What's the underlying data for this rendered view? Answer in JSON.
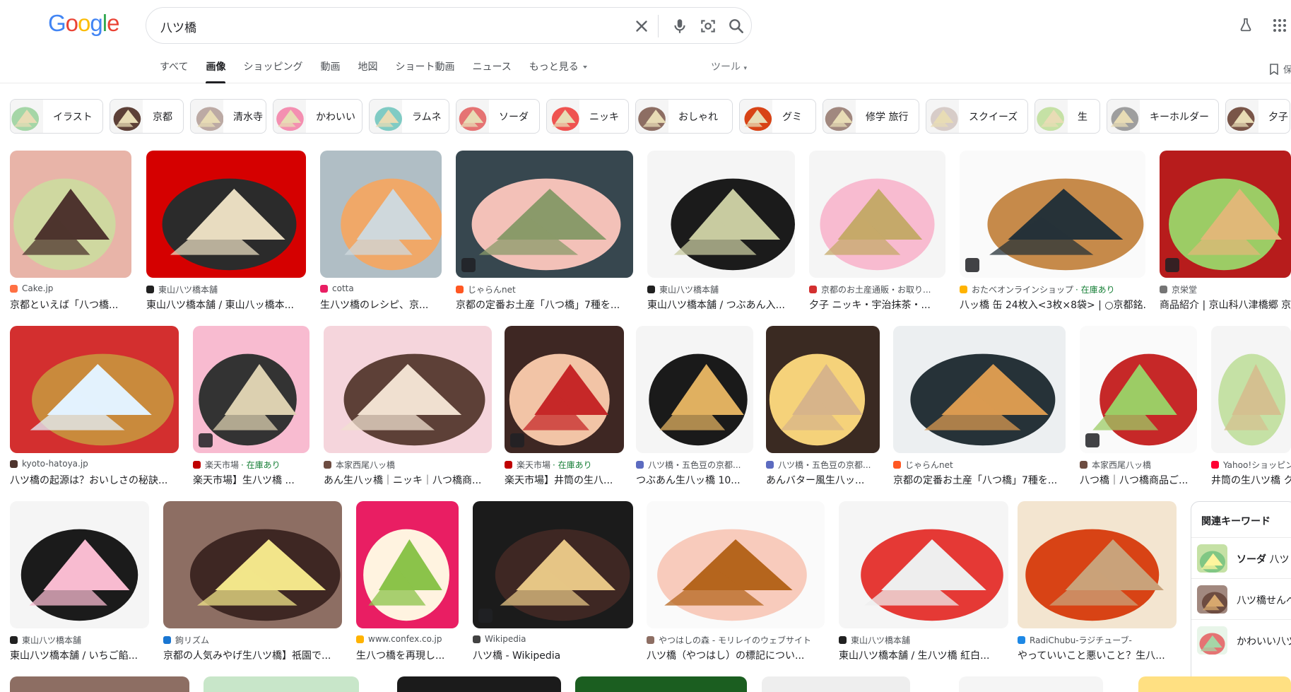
{
  "header": {
    "logo": "Google",
    "search_value": "八ツ橋",
    "tabs": [
      "すべて",
      "画像",
      "ショッピング",
      "動画",
      "地図",
      "ショート動画",
      "ニュース",
      "もっと見る"
    ],
    "tools_label": "ツール",
    "save_label": "保"
  },
  "chips": [
    {
      "label": "イラスト",
      "color": "#a5d6a7"
    },
    {
      "label": "京都",
      "color": "#5d4037"
    },
    {
      "label": "清水寺",
      "color": "#bcaaa4"
    },
    {
      "label": "かわいい",
      "color": "#f48fb1"
    },
    {
      "label": "ラムネ",
      "color": "#80cbc4"
    },
    {
      "label": "ソーダ",
      "color": "#e57373"
    },
    {
      "label": "ニッキ",
      "color": "#ef5350"
    },
    {
      "label": "おしゃれ",
      "color": "#8d6e63"
    },
    {
      "label": "グミ",
      "color": "#d84315"
    },
    {
      "label": "修学 旅行",
      "color": "#a1887f"
    },
    {
      "label": "スクイーズ",
      "color": "#d7ccc8"
    },
    {
      "label": "生",
      "color": "#c5e1a5"
    },
    {
      "label": "キーホルダー",
      "color": "#9e9e9e"
    },
    {
      "label": "夕子",
      "color": "#795548"
    }
  ],
  "rows": [
    [
      {
        "source": "Cake.jp",
        "title": "京都といえば「八つ橋...",
        "source_color": "#ff7043",
        "colors": [
          "#e8b4a8",
          "#cfd8a0",
          "#4e342e"
        ]
      },
      {
        "source": "東山八ツ橋本舗",
        "title": "東山八ツ橋本舗 / 東山八ッ橋本...",
        "source_color": "#212121",
        "colors": [
          "#d50000",
          "#2b2b2b",
          "#e8dcc0"
        ]
      },
      {
        "source": "cotta",
        "title": "生八ツ橋のレシピ、京...",
        "source_color": "#e91e63",
        "colors": [
          "#b0bec5",
          "#f0a868",
          "#cfd8dc"
        ]
      },
      {
        "source": "じゃらんnet",
        "title": "京都の定番お土産「八つ橋」7種を...",
        "source_color": "#ff5722",
        "colors": [
          "#37474f",
          "#f3c1b8",
          "#8a9a6a"
        ]
      },
      {
        "source": "東山八ツ橋本舗",
        "title": "東山八ツ橋本舗 / つぶあん入...",
        "source_color": "#212121",
        "colors": [
          "#f5f5f5",
          "#1b1b1b",
          "#c8cba0"
        ]
      },
      {
        "source": "京都のお土産通販・お取り...",
        "title": "夕子 ニッキ・宇治抹茶・...",
        "source_color": "#d32f2f",
        "colors": [
          "#f5f5f5",
          "#f8bbd0",
          "#c5a96a"
        ]
      },
      {
        "source": "おたべオンラインショップ",
        "title": "八ッ橋 缶 24枚入<3枚×8袋> | ○京都銘...",
        "source_color": "#ffb300",
        "stock": "· 在庫あり",
        "colors": [
          "#fafafa",
          "#c68a4a",
          "#263238"
        ]
      },
      {
        "source": "京栄堂",
        "title": "商品紹介 | 京山科八津橋郷 京",
        "source_color": "#757575",
        "colors": [
          "#b71c1c",
          "#9ccc65",
          "#e0b878"
        ]
      }
    ],
    [
      {
        "source": "kyoto-hatoya.jp",
        "title": "八ツ橋の起源は？おいしさの秘訣...",
        "source_color": "#4e342e",
        "colors": [
          "#d32f2f",
          "#c98a3c",
          "#e3f2fd"
        ]
      },
      {
        "source": "楽天市場",
        "title": "楽天市場】生八ツ橋 ...",
        "source_color": "#bf0000",
        "stock": "· 在庫あり",
        "colors": [
          "#f8bbd0",
          "#333333",
          "#dcd0b0"
        ]
      },
      {
        "source": "本家西尾八ッ橋",
        "title": "あん生八ッ橋｜ニッキ｜八つ橋商...",
        "source_color": "#6d4c41",
        "colors": [
          "#f5d5dc",
          "#5d4037",
          "#f0e0d0"
        ]
      },
      {
        "source": "楽天市場",
        "title": "楽天市場】井筒の生八...",
        "source_color": "#bf0000",
        "stock": "· 在庫あり",
        "colors": [
          "#3e2723",
          "#f2c4a6",
          "#c62828"
        ]
      },
      {
        "source": "八ツ橋・五色豆の京都...",
        "title": "つぶあん生八ッ橋 10...",
        "source_color": "#5c6bc0",
        "colors": [
          "#f5f5f5",
          "#1a1a1a",
          "#e0b060"
        ]
      },
      {
        "source": "八ツ橋・五色豆の京都...",
        "title": "あんバター風生八ッ...",
        "source_color": "#5c6bc0",
        "colors": [
          "#3a2a22",
          "#f5d27a",
          "#d7b48a"
        ]
      },
      {
        "source": "じゃらんnet",
        "title": "京都の定番お土産「八つ橋」7種を...",
        "source_color": "#ff5722",
        "colors": [
          "#eceff1",
          "#263238",
          "#d99a50"
        ]
      },
      {
        "source": "本家西尾八ッ橋",
        "title": "八つ橋｜八つ橋商品ご...",
        "source_color": "#6d4c41",
        "colors": [
          "#fafafa",
          "#c62828",
          "#9ccc65"
        ]
      },
      {
        "source": "Yahoo!ショッピン",
        "title": "井筒の生八ツ橋 ク",
        "source_color": "#ff0033",
        "colors": [
          "#f5f5f5",
          "#c5e1a5",
          "#d4c090"
        ]
      }
    ],
    [
      {
        "source": "東山八ツ橋本舗",
        "title": "東山八ツ橋本舗 / いちご餡...",
        "source_color": "#212121",
        "colors": [
          "#f5f5f5",
          "#1b1b1b",
          "#f8bbd0"
        ]
      },
      {
        "source": "鉤リズム",
        "title": "京都の人気みやげ生八ツ橋】祇園で...",
        "source_color": "#1976d2",
        "colors": [
          "#8d6e63",
          "#3e2723",
          "#f2e58a"
        ]
      },
      {
        "source": "www.confex.co.jp",
        "title": "生八つ橋を再現し...",
        "source_color": "#ffb300",
        "colors": [
          "#e91e63",
          "#fff3e0",
          "#8bc34a"
        ]
      },
      {
        "source": "Wikipedia",
        "title": "八ツ橋 - Wikipedia",
        "source_color": "#424242",
        "colors": [
          "#1b1b1b",
          "#3e2723",
          "#e6c585"
        ]
      },
      {
        "source": "やつはしの森 - モリレイのウェブサイト",
        "title": "八ツ橋（やつはし）の標記につい...",
        "source_color": "#8d6e63",
        "colors": [
          "#fafafa",
          "#f8cbbc",
          "#b5651d"
        ]
      },
      {
        "source": "東山八ツ橋本舗",
        "title": "東山八ツ橋本舗 / 生八ツ橋 紅白...",
        "source_color": "#212121",
        "colors": [
          "#f5f5f5",
          "#e53935",
          "#eeeeee"
        ]
      },
      {
        "source": "RadiChubu-ラジチューブ-",
        "title": "やっていいこと悪いこと？生八...",
        "source_color": "#1e88e5",
        "colors": [
          "#f3e5d0",
          "#d84315",
          "#c9a27a"
        ]
      }
    ]
  ],
  "related": {
    "title": "関連キーワード",
    "items": [
      {
        "label": "ソーダ",
        "suffix": " 八ツ",
        "bold": true
      },
      {
        "label": "八ツ橋せんべ",
        "suffix": "",
        "bold": false
      },
      {
        "label": "かわいい八ツ",
        "suffix": "",
        "bold": false
      }
    ]
  },
  "colors": {
    "accent": "#1a73e8",
    "stock": "#188038",
    "text": "#202124"
  }
}
